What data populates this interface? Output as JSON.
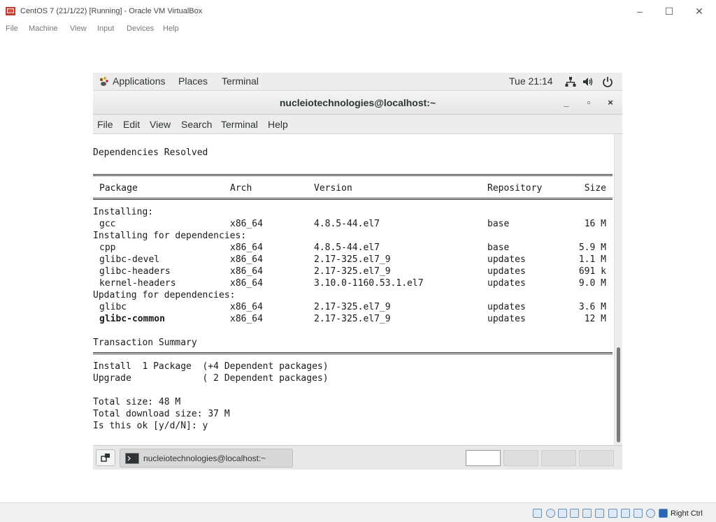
{
  "vbox": {
    "title": "CentOS 7 (21/1/22) [Running] - Oracle VM VirtualBox",
    "menu": [
      "File",
      "Machine",
      "View",
      "Input",
      "Devices",
      "Help"
    ],
    "minimize": "–",
    "maximize": "☐",
    "close": "✕",
    "host_key": "Right Ctrl"
  },
  "gnome": {
    "applications": "Applications",
    "places": "Places",
    "terminal": "Terminal",
    "clock": "Tue 21:14"
  },
  "terminal": {
    "title": "nucleiotechnologies@localhost:~",
    "menu": [
      "File",
      "Edit",
      "View",
      "Search",
      "Terminal",
      "Help"
    ],
    "btn_min": "_",
    "btn_max": "▫",
    "btn_close": "×",
    "dependencies_resolved": "Dependencies Resolved",
    "headers": {
      "package": "Package",
      "arch": "Arch",
      "version": "Version",
      "repository": "Repository",
      "size": "Size"
    },
    "section_installing": "Installing:",
    "section_installing_deps": "Installing for dependencies:",
    "section_updating_deps": "Updating for dependencies:",
    "installing": [
      {
        "package": "gcc",
        "arch": "x86_64",
        "version": "4.8.5-44.el7",
        "repository": "base",
        "size": "16 M"
      }
    ],
    "installing_deps": [
      {
        "package": "cpp",
        "arch": "x86_64",
        "version": "4.8.5-44.el7",
        "repository": "base",
        "size": "5.9 M"
      },
      {
        "package": "glibc-devel",
        "arch": "x86_64",
        "version": "2.17-325.el7_9",
        "repository": "updates",
        "size": "1.1 M"
      },
      {
        "package": "glibc-headers",
        "arch": "x86_64",
        "version": "2.17-325.el7_9",
        "repository": "updates",
        "size": "691 k"
      },
      {
        "package": "kernel-headers",
        "arch": "x86_64",
        "version": "3.10.0-1160.53.1.el7",
        "repository": "updates",
        "size": "9.0 M"
      }
    ],
    "updating_deps": [
      {
        "package": "glibc",
        "arch": "x86_64",
        "version": "2.17-325.el7_9",
        "repository": "updates",
        "size": "3.6 M"
      },
      {
        "package": "glibc-common",
        "arch": "x86_64",
        "version": "2.17-325.el7_9",
        "repository": "updates",
        "size": "12 M"
      }
    ],
    "transaction_summary": "Transaction Summary",
    "install_line": "Install  1 Package  (+4 Dependent packages)",
    "upgrade_line": "Upgrade             ( 2 Dependent packages)",
    "total_size": "Total size: 48 M",
    "total_download": "Total download size: 37 M",
    "prompt": "Is this ok [y/d/N]: y"
  },
  "taskbar": {
    "window_label": "nucleiotechnologies@localhost:~"
  }
}
